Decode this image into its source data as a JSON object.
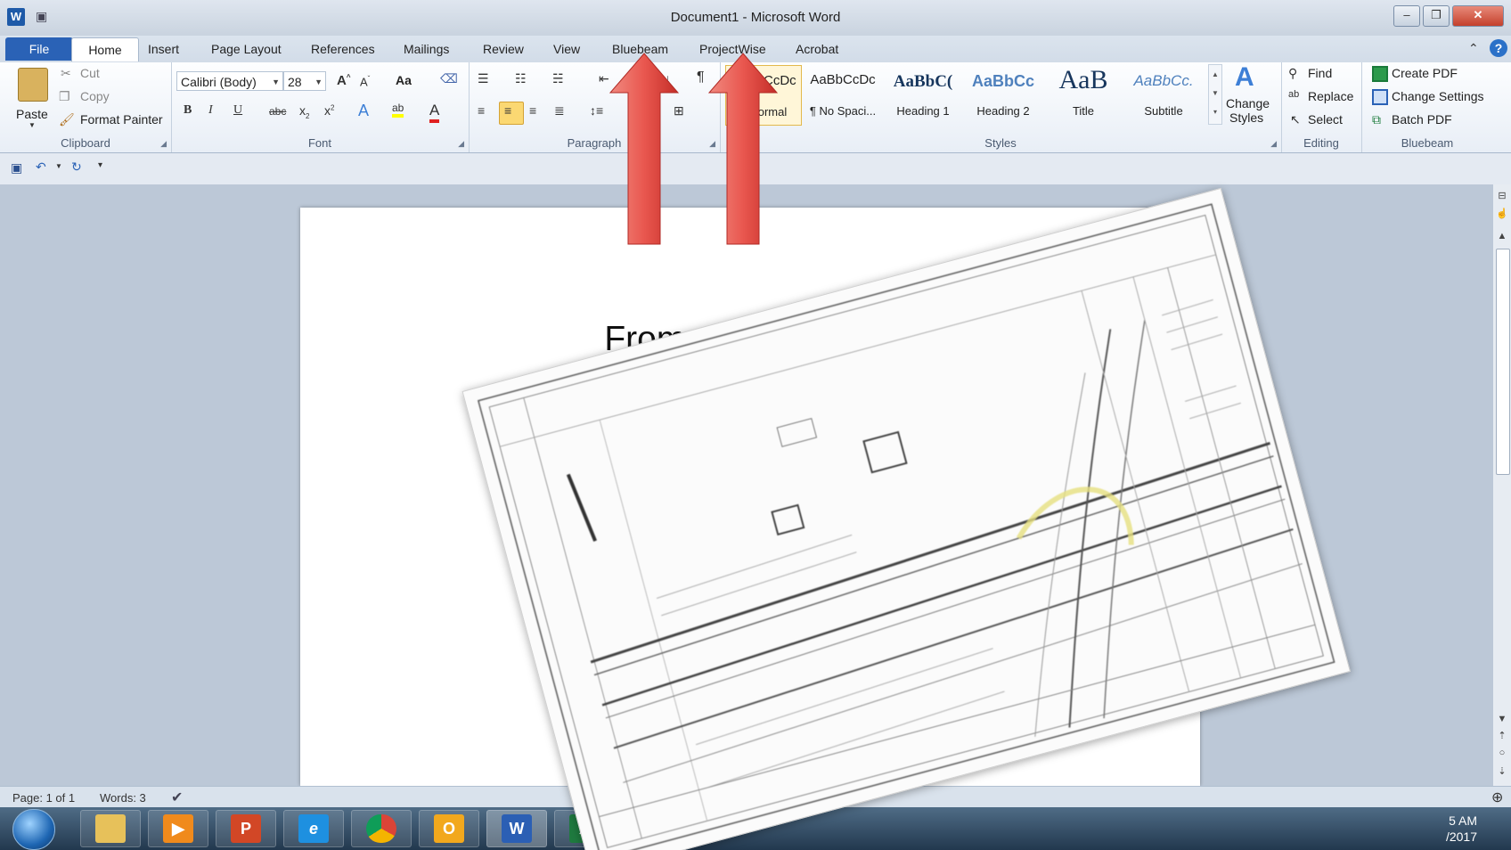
{
  "window": {
    "title": "Document1  -  Microsoft Word",
    "app_icon": "W",
    "minimize_label": "–",
    "restore_label": "❐",
    "close_label": "✕"
  },
  "tabs": [
    "File",
    "Home",
    "Insert",
    "Page Layout",
    "References",
    "Mailings",
    "Review",
    "View",
    "Bluebeam",
    "ProjectWise",
    "Acrobat"
  ],
  "ribbon": {
    "clipboard": {
      "paste": "Paste",
      "cut": "Cut",
      "copy": "Copy",
      "format_painter": "Format Painter",
      "label": "Clipboard"
    },
    "font": {
      "family": "Calibri (Body)",
      "size": "28",
      "change_case": "Aa",
      "label": "Font"
    },
    "paragraph": {
      "label": "Paragraph"
    },
    "styles": {
      "items": [
        {
          "sample": "AaBbCcDc",
          "name": "¶ Normal"
        },
        {
          "sample": "AaBbCcDc",
          "name": "¶ No Spaci..."
        },
        {
          "sample": "AaBbC(",
          "name": "Heading 1"
        },
        {
          "sample": "AaBbCc",
          "name": "Heading 2"
        },
        {
          "sample": "AaB",
          "name": "Title"
        },
        {
          "sample": "AaBbCc.",
          "name": "Subtitle"
        }
      ],
      "change_styles_1": "Change",
      "change_styles_2": "Styles",
      "label": "Styles"
    },
    "editing": {
      "find": "Find",
      "replace": "Replace",
      "select": "Select",
      "label": "Editing"
    },
    "bluebeam": {
      "create_pdf": "Create PDF",
      "change_settings": "Change Settings",
      "batch_pdf": "Batch PDF",
      "label": "Bluebeam"
    }
  },
  "document": {
    "text": "From one screen..."
  },
  "status": {
    "page": "Page: 1 of 1",
    "words": "Words: 3"
  },
  "taskbar": {
    "apps": [
      "explorer",
      "media-player",
      "powerpoint",
      "internet-explorer",
      "chrome",
      "outlook",
      "word",
      "excel"
    ],
    "time": "5 AM",
    "date": "/2017"
  },
  "colors": {
    "arrow": "#d9403a",
    "accent": "#2a62b6",
    "workspace": "#bcc8d7"
  }
}
